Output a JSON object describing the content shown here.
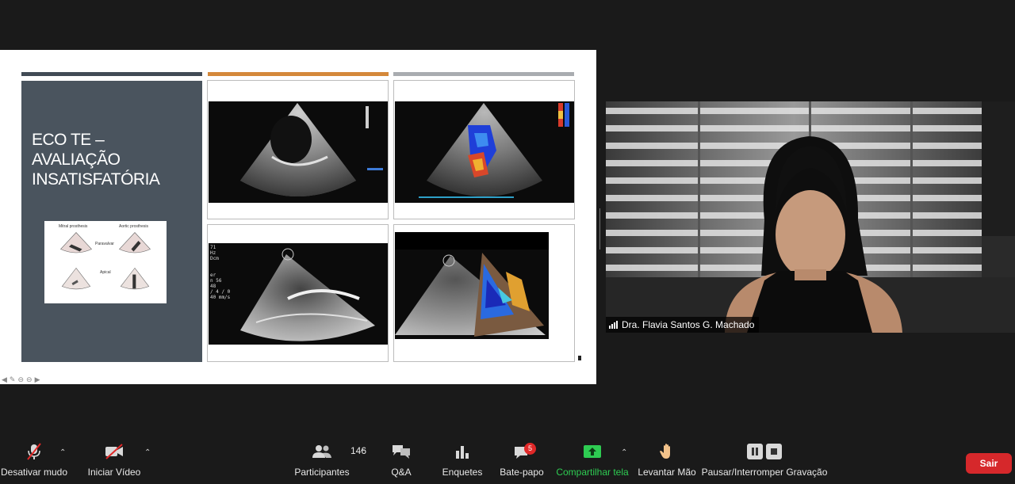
{
  "slide": {
    "title_lines": [
      "ECO TE –",
      "AVALIAÇÃO",
      "INSATISFATÓRIA"
    ],
    "figure": {
      "label_mitral": "Mitral prosthesis",
      "label_aortic": "Aortic prosthesis",
      "label_paravalvar": "Paravalvar",
      "label_apical": "Apical"
    },
    "echo3_overlay": [
      "71",
      "Hz",
      "Dcm",
      "er",
      "n 56",
      "48",
      "/ 4 / 0",
      "40 mm/s"
    ],
    "controls": [
      "back-arrow",
      "pen",
      "zoom-out",
      "zoom-in",
      "forward-arrow"
    ]
  },
  "video": {
    "participant_name": "Dra. Flavia Santos G. Machado"
  },
  "toolbar": {
    "mute_label": "Desativar mudo",
    "video_label": "Iniciar Vídeo",
    "participants_label": "Participantes",
    "participants_count": "146",
    "qa_label": "Q&A",
    "polls_label": "Enquetes",
    "chat_label": "Bate-papo",
    "chat_badge": "5",
    "share_label": "Compartilhar tela",
    "raise_hand_label": "Levantar Mão",
    "recording_label": "Pausar/Interromper Gravação",
    "leave_label": "Sair"
  },
  "colors": {
    "share_green": "#2ecc52",
    "leave_red": "#d6282b",
    "badge_red": "#e02828"
  }
}
